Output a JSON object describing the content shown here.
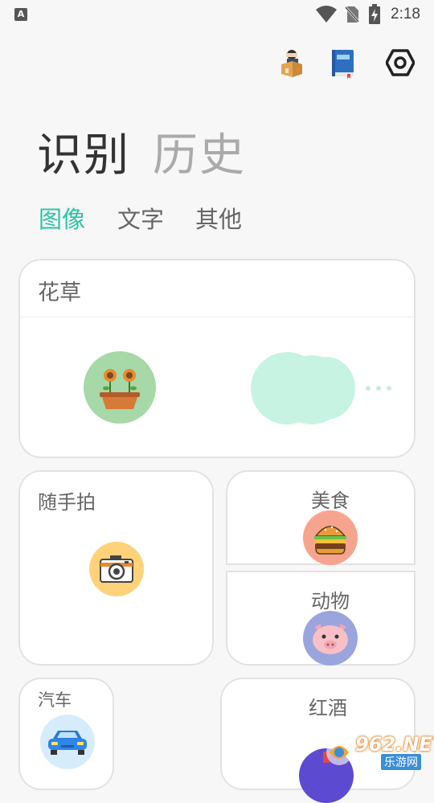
{
  "status_bar": {
    "app_icon_letter": "A",
    "time": "2:18"
  },
  "header": {
    "title": "识别",
    "subtitle": "历史"
  },
  "tabs": [
    {
      "label": "图像",
      "active": true
    },
    {
      "label": "文字",
      "active": false
    },
    {
      "label": "其他",
      "active": false
    }
  ],
  "cards": {
    "flower": {
      "title": "花草",
      "icon": "flower-pot-icon"
    },
    "snap": {
      "title": "随手拍",
      "icon": "camera-icon"
    },
    "food": {
      "title": "美食",
      "icon": "burger-icon"
    },
    "animal": {
      "title": "动物",
      "icon": "pig-icon"
    },
    "car": {
      "title": "汽车",
      "icon": "car-icon"
    },
    "wine": {
      "title": "红酒",
      "icon": "wine-icon"
    }
  },
  "watermark": {
    "text": "962.NET",
    "subtext": "乐游网"
  },
  "colors": {
    "accent": "#2cc3a6",
    "flower_circle": "#a6d8a8",
    "snap_circle": "#ffd27a",
    "food_circle": "#f7a48f",
    "animal_circle": "#9aa5dd",
    "car_circle": "#d7ecfb",
    "blob": "#c7f3e2"
  }
}
